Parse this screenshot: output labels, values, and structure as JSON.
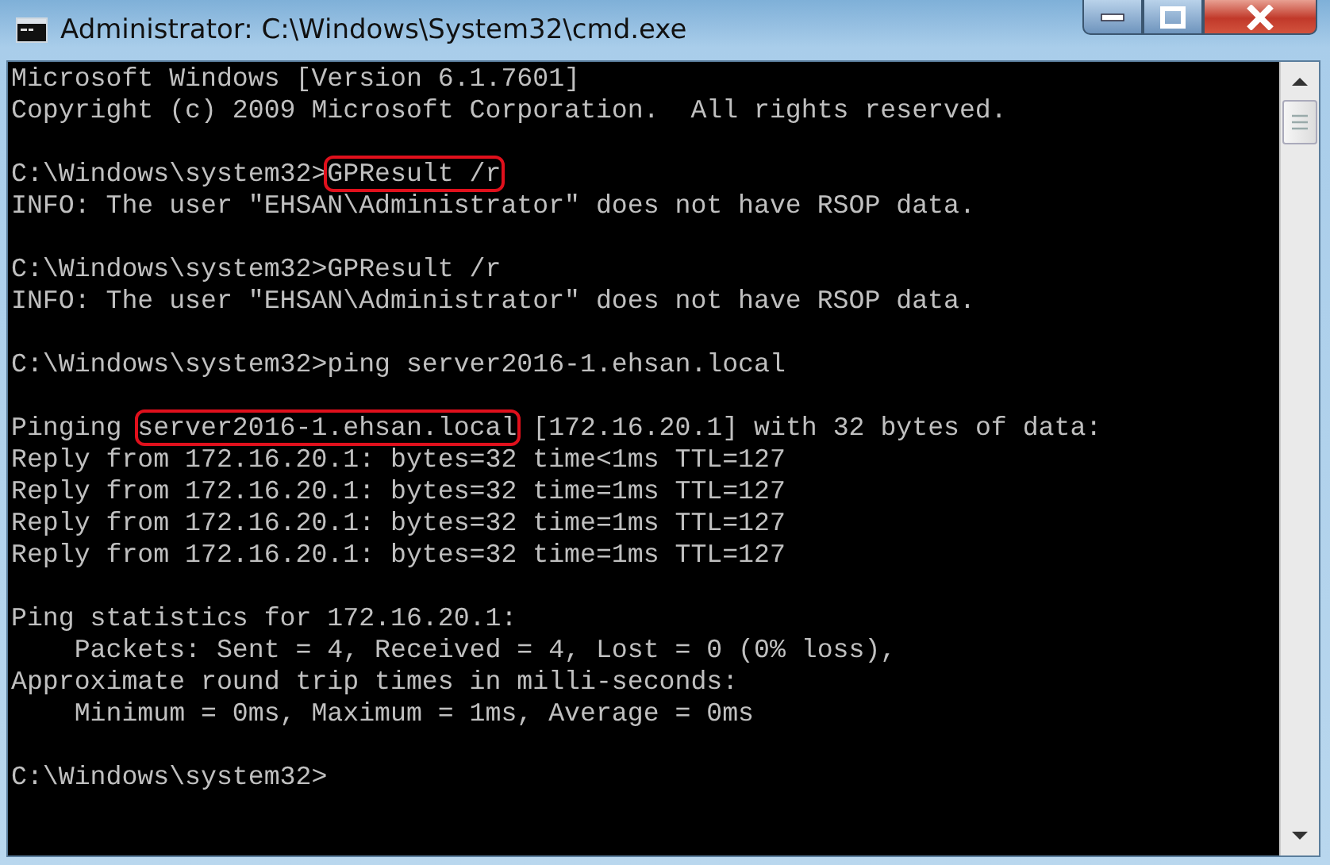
{
  "window": {
    "title": "Administrator: C:\\Windows\\System32\\cmd.exe"
  },
  "console": {
    "lines": [
      {
        "kind": "text",
        "segments": [
          {
            "text": "Microsoft Windows [Version 6.1.7601]",
            "circled": false
          }
        ]
      },
      {
        "kind": "text",
        "segments": [
          {
            "text": "Copyright (c) 2009 Microsoft Corporation.  All rights reserved.",
            "circled": false
          }
        ]
      },
      {
        "kind": "blank"
      },
      {
        "kind": "text",
        "segments": [
          {
            "text": "C:\\Windows\\system32>",
            "circled": false
          },
          {
            "text": "GPResult /r",
            "circled": true
          }
        ]
      },
      {
        "kind": "text",
        "segments": [
          {
            "text": "INFO: The user \"EHSAN\\Administrator\" does not have RSOP data.",
            "circled": false
          }
        ]
      },
      {
        "kind": "blank"
      },
      {
        "kind": "text",
        "segments": [
          {
            "text": "C:\\Windows\\system32>GPResult /r",
            "circled": false
          }
        ]
      },
      {
        "kind": "text",
        "segments": [
          {
            "text": "INFO: The user \"EHSAN\\Administrator\" does not have RSOP data.",
            "circled": false
          }
        ]
      },
      {
        "kind": "blank"
      },
      {
        "kind": "text",
        "segments": [
          {
            "text": "C:\\Windows\\system32>ping server2016-1.ehsan.local",
            "circled": false
          }
        ]
      },
      {
        "kind": "blank"
      },
      {
        "kind": "text",
        "segments": [
          {
            "text": "Pinging ",
            "circled": false
          },
          {
            "text": "server2016-1.ehsan.local",
            "circled": true
          },
          {
            "text": " [172.16.20.1] with 32 bytes of data:",
            "circled": false
          }
        ]
      },
      {
        "kind": "text",
        "segments": [
          {
            "text": "Reply from 172.16.20.1: bytes=32 time<1ms TTL=127",
            "circled": false
          }
        ]
      },
      {
        "kind": "text",
        "segments": [
          {
            "text": "Reply from 172.16.20.1: bytes=32 time=1ms TTL=127",
            "circled": false
          }
        ]
      },
      {
        "kind": "text",
        "segments": [
          {
            "text": "Reply from 172.16.20.1: bytes=32 time=1ms TTL=127",
            "circled": false
          }
        ]
      },
      {
        "kind": "text",
        "segments": [
          {
            "text": "Reply from 172.16.20.1: bytes=32 time=1ms TTL=127",
            "circled": false
          }
        ]
      },
      {
        "kind": "blank"
      },
      {
        "kind": "text",
        "segments": [
          {
            "text": "Ping statistics for 172.16.20.1:",
            "circled": false
          }
        ]
      },
      {
        "kind": "text",
        "segments": [
          {
            "text": "    Packets: Sent = 4, Received = 4, Lost = 0 (0% loss),",
            "circled": false
          }
        ]
      },
      {
        "kind": "text",
        "segments": [
          {
            "text": "Approximate round trip times in milli-seconds:",
            "circled": false
          }
        ]
      },
      {
        "kind": "text",
        "segments": [
          {
            "text": "    Minimum = 0ms, Maximum = 1ms, Average = 0ms",
            "circled": false
          }
        ]
      },
      {
        "kind": "blank"
      },
      {
        "kind": "text",
        "segments": [
          {
            "text": "C:\\Windows\\system32>",
            "circled": false
          }
        ]
      }
    ]
  }
}
